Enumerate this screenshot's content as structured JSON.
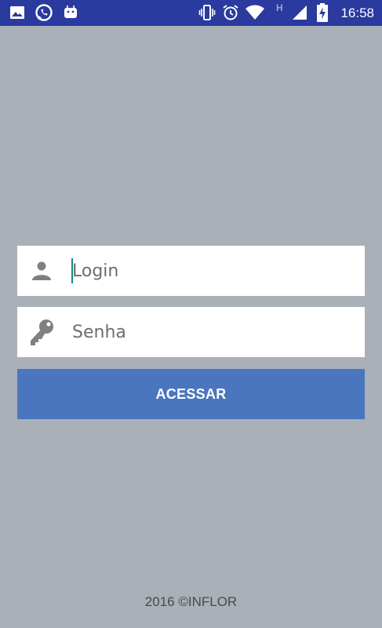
{
  "status_bar": {
    "time": "16:58",
    "network_label": "H",
    "icons": [
      "gallery-icon",
      "whatsapp-icon",
      "android-icon",
      "vibrate-icon",
      "alarm-icon",
      "wifi-icon",
      "signal-icon",
      "battery-charging-icon"
    ]
  },
  "login_form": {
    "login_placeholder": "Login",
    "password_placeholder": "Senha",
    "submit_label": "ACESSAR",
    "submit_color": "#4a76c0"
  },
  "footer": {
    "text": "2016 ©INFLOR"
  },
  "colors": {
    "background": "#a9b0b8",
    "status_bar": "#2b3a9f",
    "cursor": "#1a8a7a"
  }
}
